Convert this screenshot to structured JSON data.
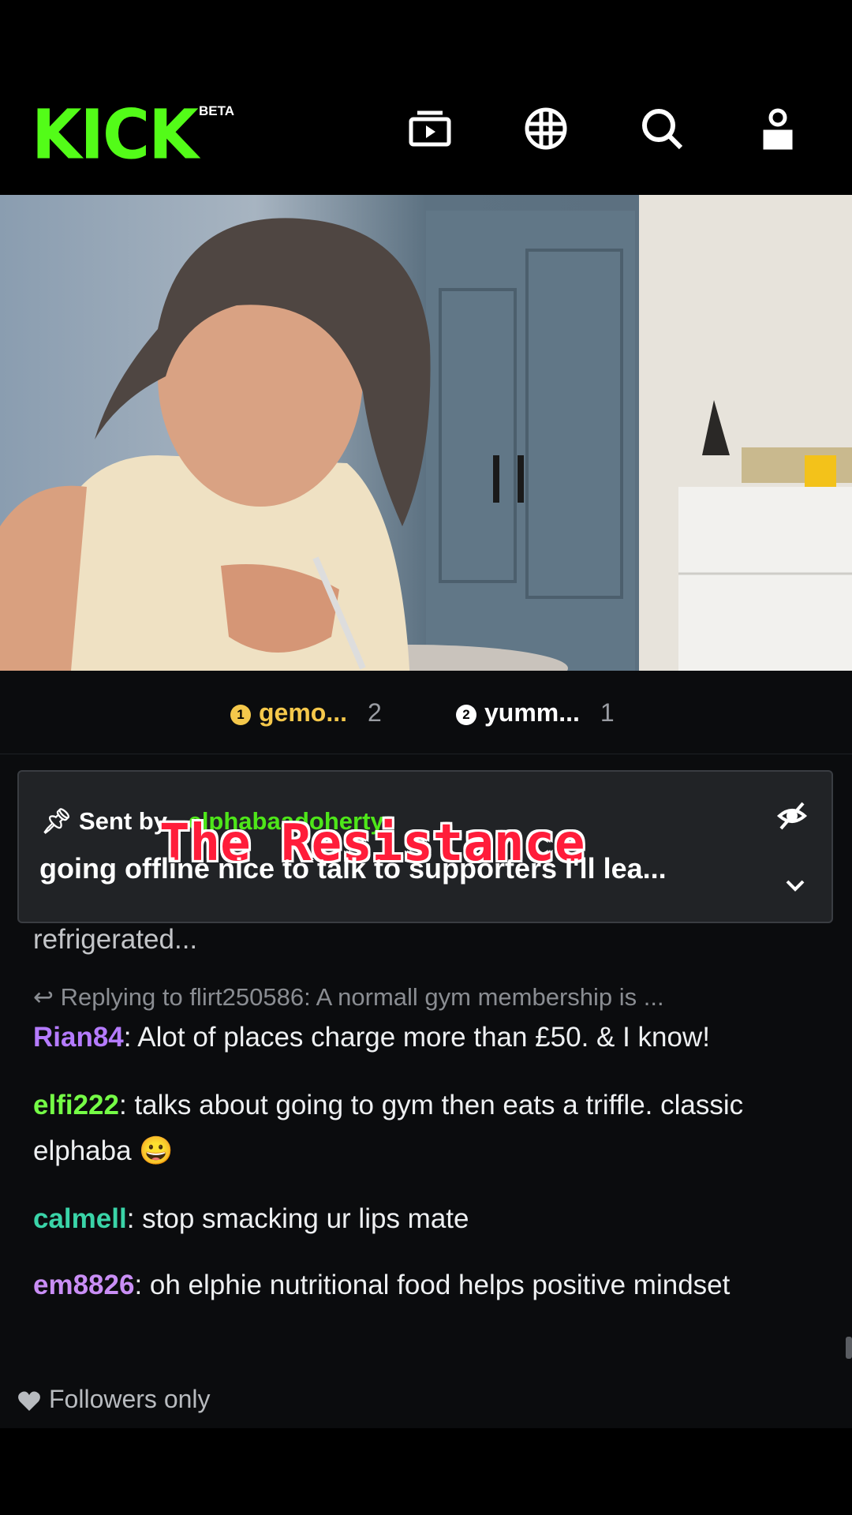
{
  "header": {
    "logo": "KICK",
    "badge": "BETA",
    "icons": [
      "browse-icon",
      "globe-icon",
      "search-icon",
      "user-icon"
    ]
  },
  "leaderboard": [
    {
      "rank": "1",
      "name": "gemo...",
      "count": "2",
      "color": "#f5c84b"
    },
    {
      "rank": "2",
      "name": "yumm...",
      "count": "1",
      "color": "#ffffff"
    }
  ],
  "pinned": {
    "prefix": "Sent by",
    "user": "elphabaadoherty",
    "message": "going offline nice to talk to supporters I'll lea...",
    "overlay": "The Resistance",
    "behind_text": "refrigerated..."
  },
  "chat": {
    "reply_context": "Replying to flirt250586: A normall gym membership is ...",
    "messages": [
      {
        "user": "Rian84",
        "color": "#b57bff",
        "text": ": Alot of places charge more than £50. & I know!"
      },
      {
        "user": "elfi222",
        "color": "#75fd46",
        "text": ": talks about going to gym then eats a triffle. classic elphaba 😀"
      },
      {
        "user": "calmell",
        "color": "#3ad4a8",
        "text": ": stop smacking ur lips mate"
      },
      {
        "user": "em8826",
        "color": "#c98ef5",
        "text": ": oh elphie nutritional food helps positive mindset"
      }
    ]
  },
  "footer": {
    "label": "Followers only"
  },
  "colors": {
    "brand": "#53fc18",
    "background": "#0b0c0e",
    "pinned_bg": "#212326"
  }
}
